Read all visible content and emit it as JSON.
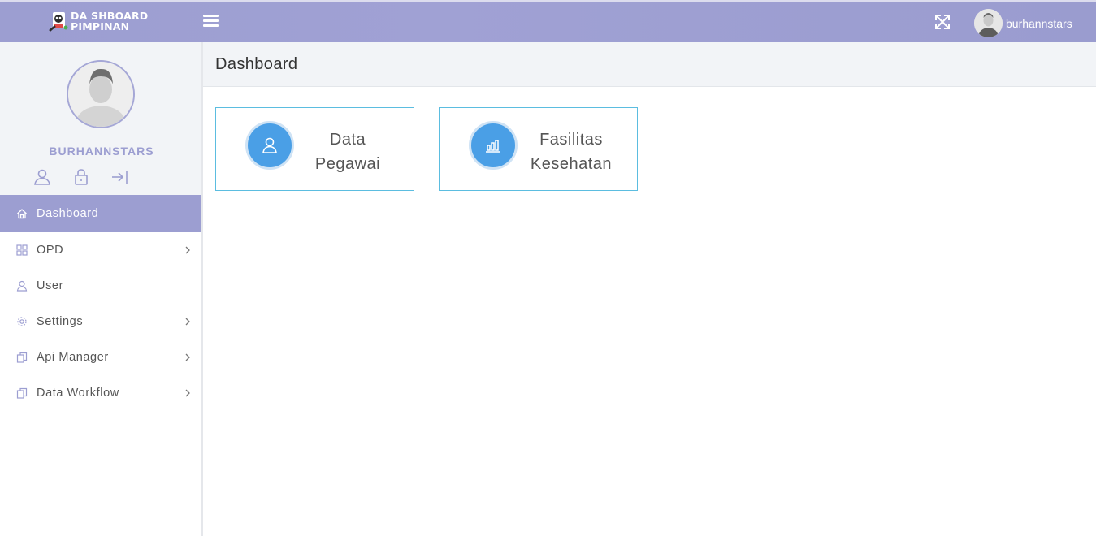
{
  "topbar": {
    "logo_line1": "DA SHBOARD",
    "logo_line2": "PIMPINAN",
    "username": "burhannstars",
    "icons": [
      "menu-icon",
      "fullscreen-icon"
    ]
  },
  "sidebar": {
    "profile_name": "BURHANNSTARS",
    "profile_icons": [
      "user-icon",
      "lock-icon",
      "logout-icon"
    ],
    "items": [
      {
        "label": "Dashboard",
        "icon": "home-icon",
        "active": true,
        "has_children": false
      },
      {
        "label": "OPD",
        "icon": "grid-icon",
        "active": false,
        "has_children": true
      },
      {
        "label": "User",
        "icon": "user-icon",
        "active": false,
        "has_children": false
      },
      {
        "label": "Settings",
        "icon": "gear-icon",
        "active": false,
        "has_children": true
      },
      {
        "label": "Api Manager",
        "icon": "copy-icon",
        "active": false,
        "has_children": true
      },
      {
        "label": "Data Workflow",
        "icon": "copy-icon",
        "active": false,
        "has_children": true
      }
    ]
  },
  "main": {
    "title": "Dashboard",
    "cards": [
      {
        "line1": "Data",
        "line2": "Pegawai",
        "icon": "user-icon"
      },
      {
        "line1": "Fasilitas",
        "line2": "Kesehatan",
        "icon": "bar-chart-icon"
      }
    ]
  },
  "colors": {
    "accent": "#9c9ed1",
    "card_border": "#5bbde0",
    "card_icon_bg": "#4a9fe6"
  }
}
